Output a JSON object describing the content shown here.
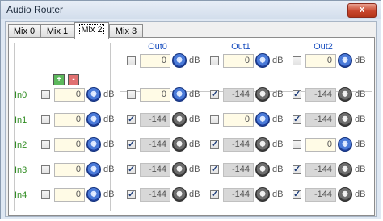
{
  "window": {
    "title": "Audio Router",
    "close_glyph": "x"
  },
  "tabs": [
    {
      "label": "Mix 0"
    },
    {
      "label": "Mix 1"
    },
    {
      "label": "Mix 2",
      "active": true
    },
    {
      "label": "Mix 3"
    }
  ],
  "buttons": {
    "add_label": "+",
    "remove_label": "-"
  },
  "outputs": [
    {
      "label": "Out0",
      "checked": false,
      "value": "0",
      "enabled": true
    },
    {
      "label": "Out1",
      "checked": false,
      "value": "0",
      "enabled": true
    },
    {
      "label": "Out2",
      "checked": false,
      "value": "0",
      "enabled": true
    }
  ],
  "unit": "dB",
  "inputs": [
    {
      "label": "In0",
      "checked": false,
      "value": "0",
      "cells": [
        {
          "checked": false,
          "value": "0",
          "enabled": true
        },
        {
          "checked": true,
          "value": "-144",
          "enabled": false
        },
        {
          "checked": true,
          "value": "-144",
          "enabled": false
        }
      ]
    },
    {
      "label": "In1",
      "checked": false,
      "value": "0",
      "cells": [
        {
          "checked": true,
          "value": "-144",
          "enabled": false
        },
        {
          "checked": false,
          "value": "0",
          "enabled": true
        },
        {
          "checked": true,
          "value": "-144",
          "enabled": false
        }
      ]
    },
    {
      "label": "In2",
      "checked": false,
      "value": "0",
      "cells": [
        {
          "checked": true,
          "value": "-144",
          "enabled": false
        },
        {
          "checked": true,
          "value": "-144",
          "enabled": false
        },
        {
          "checked": false,
          "value": "0",
          "enabled": true
        }
      ]
    },
    {
      "label": "In3",
      "checked": false,
      "value": "0",
      "cells": [
        {
          "checked": true,
          "value": "-144",
          "enabled": false
        },
        {
          "checked": true,
          "value": "-144",
          "enabled": false
        },
        {
          "checked": true,
          "value": "-144",
          "enabled": false
        }
      ]
    },
    {
      "label": "In4",
      "checked": false,
      "value": "0",
      "cells": [
        {
          "checked": true,
          "value": "-144",
          "enabled": false
        },
        {
          "checked": true,
          "value": "-144",
          "enabled": false
        },
        {
          "checked": true,
          "value": "-144",
          "enabled": false
        }
      ]
    }
  ]
}
